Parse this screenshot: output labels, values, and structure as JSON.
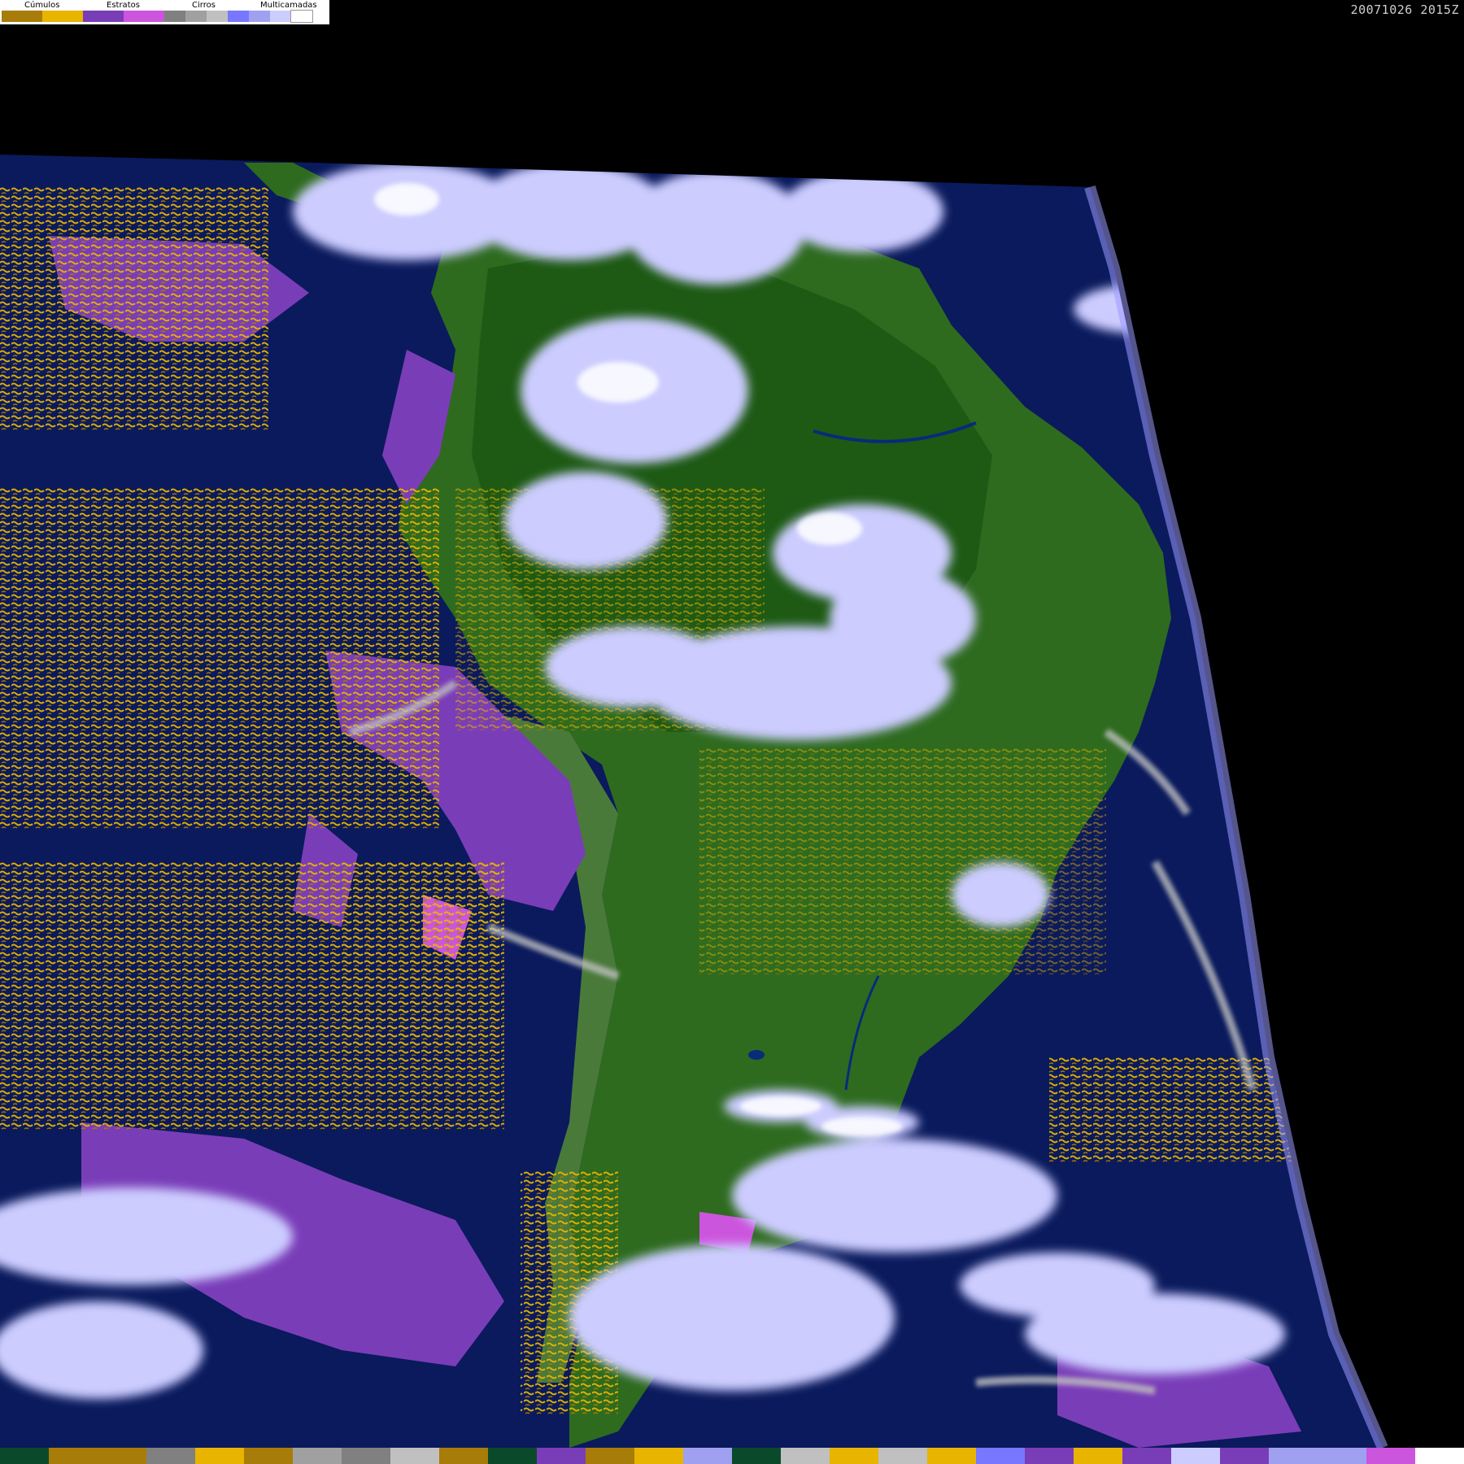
{
  "legend": {
    "groups": [
      {
        "label": "Cúmulos",
        "colors": [
          "#a87c08",
          "#e8b400"
        ]
      },
      {
        "label": "Estratos",
        "colors": [
          "#7a3db8",
          "#cc55dd"
        ]
      },
      {
        "label": "Cirros",
        "colors": [
          "#808080",
          "#a0a0a0",
          "#c0c0c0"
        ]
      },
      {
        "label": "Multicamadas",
        "colors": [
          "#7777ff",
          "#a0a0f0",
          "#ccccff",
          "#ffffff"
        ]
      }
    ]
  },
  "timestamp": "20071026 2015Z",
  "colors": {
    "ocean": "#0a1a5c",
    "land": "#2e6b1f",
    "cumulus": "#e8b400",
    "stratus": "#7a3db8",
    "cirrus": "#c0c0c0",
    "multilayer": "#ccccff"
  },
  "palette_bar": [
    "#0a4a2a",
    "#a87c08",
    "#a87c08",
    "#808080",
    "#e8b400",
    "#a87c08",
    "#a0a0a0",
    "#808080",
    "#c0c0c0",
    "#a87c08",
    "#0a4a2a",
    "#7a3db8",
    "#a87c08",
    "#e8b400",
    "#a0a0f0",
    "#0a4a2a",
    "#c0c0c0",
    "#e8b400",
    "#c0c0c0",
    "#e8b400",
    "#7777ff",
    "#7a3db8",
    "#e8b400",
    "#7a3db8",
    "#ccccff",
    "#7a3db8",
    "#a0a0f0",
    "#a0a0f0",
    "#cc55dd",
    "#ffffff"
  ]
}
